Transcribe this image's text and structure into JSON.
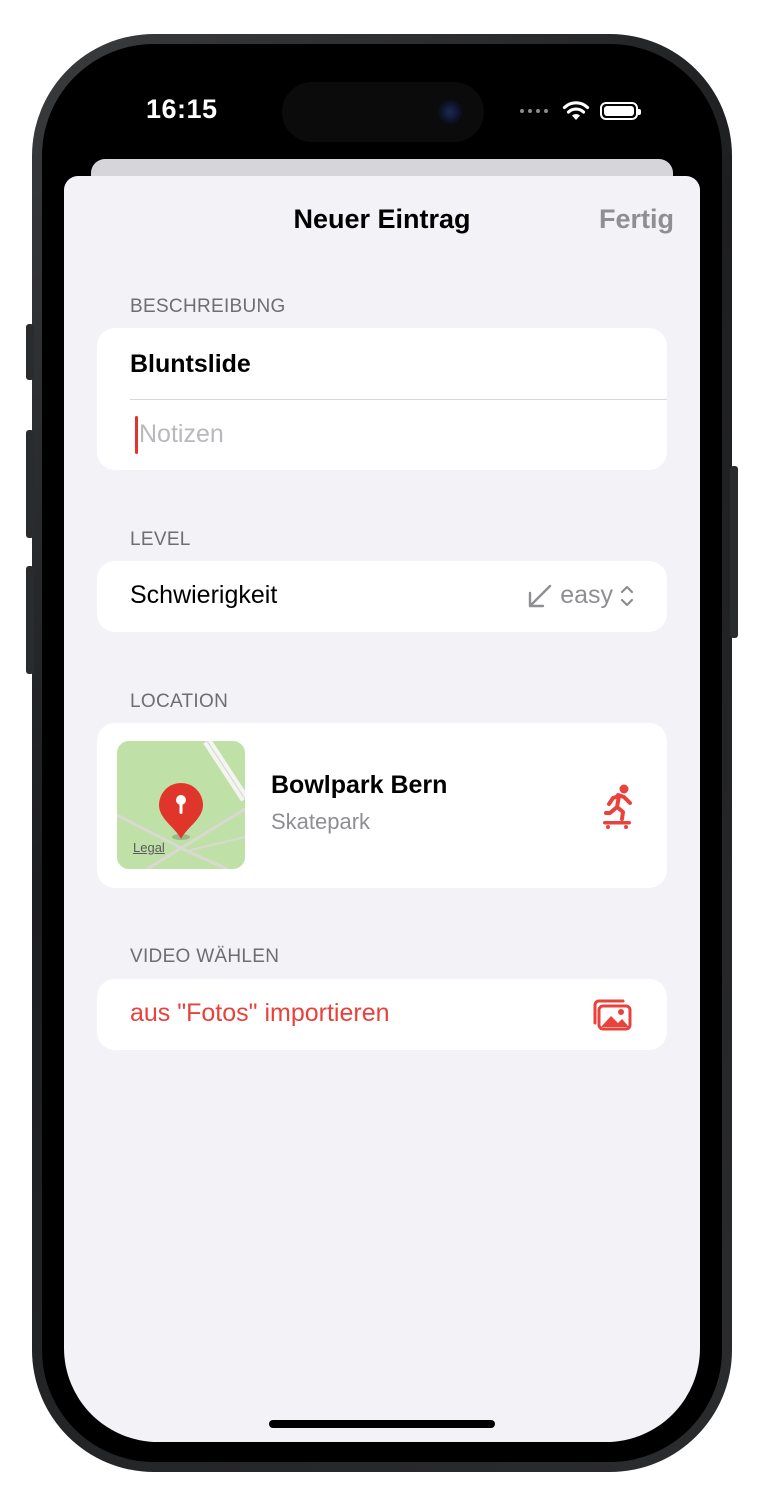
{
  "status_bar": {
    "time": "16:15",
    "signal_icon": "signal-dots-icon",
    "wifi_icon": "wifi-icon",
    "battery_icon": "battery-icon"
  },
  "nav": {
    "title": "Neuer Eintrag",
    "done_label": "Fertig"
  },
  "description_section": {
    "header": "BESCHREIBUNG",
    "title_value": "Bluntslide",
    "notes_placeholder": "Notizen"
  },
  "level_section": {
    "header": "LEVEL",
    "label": "Schwierigkeit",
    "selected_value": "easy",
    "value_icon": "arrow-down-left-icon",
    "picker_icon": "chevron-up-down-icon"
  },
  "location_section": {
    "header": "LOCATION",
    "map_legal": "Legal",
    "place_name": "Bowlpark Bern",
    "place_type": "Skatepark",
    "type_icon": "skateboarder-icon"
  },
  "video_section": {
    "header": "VIDEO WÄHLEN",
    "import_label": "aus \"Fotos\" importieren",
    "import_icon": "photo-library-icon"
  },
  "colors": {
    "accent": "#e9423a",
    "secondary_text": "#8e8e93",
    "background": "#f2f2f7",
    "map_green": "#bfe0a7",
    "pin_red": "#e0352b"
  }
}
